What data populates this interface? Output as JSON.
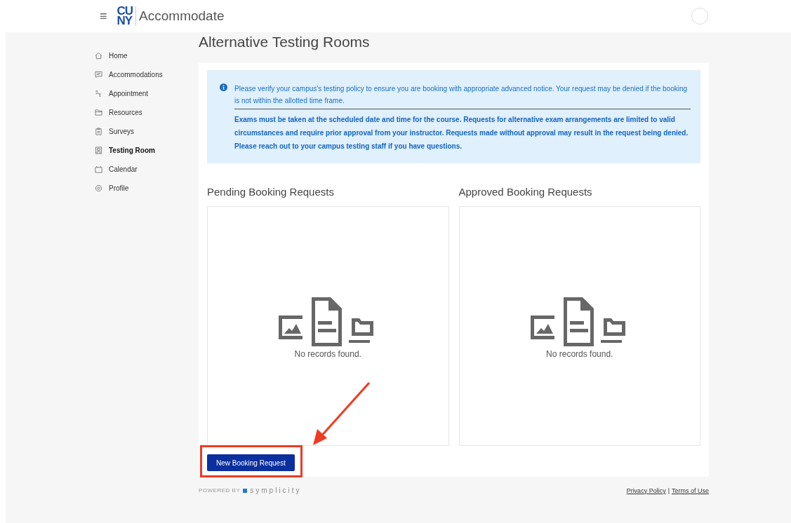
{
  "header": {
    "menu_glyph": "≡",
    "logo_lines": [
      "CU",
      "NY"
    ],
    "app_name": "Accommodate"
  },
  "sidebar": {
    "items": [
      {
        "label": "Home",
        "selected": false
      },
      {
        "label": "Accommodations",
        "selected": false
      },
      {
        "label": "Appointment",
        "selected": false
      },
      {
        "label": "Resources",
        "selected": false
      },
      {
        "label": "Surveys",
        "selected": false
      },
      {
        "label": "Testing Room",
        "selected": true
      },
      {
        "label": "Calendar",
        "selected": false
      },
      {
        "label": "Profile",
        "selected": false
      }
    ]
  },
  "page_title": "Alternative Testing Rooms",
  "notice": {
    "text": "Please verify your campus's testing policy to ensure you are booking with appropriate advanced notice. Your request may be denied if the booking is not within the allotted time frame.",
    "bold_text": "Exams must be taken at the scheduled date and time for the course. Requests for alternative exam arrangements are limited to valid circumstances and require prior approval from your instructor. Requests made without approval may result in the request being denied. Please reach out to your campus testing staff if you have questions."
  },
  "panels": [
    {
      "title": "Pending Booking Requests",
      "empty_text": "No records found."
    },
    {
      "title": "Approved Booking Requests",
      "empty_text": "No records found."
    }
  ],
  "new_button": "New Booking Request",
  "footer": {
    "powered_by": "POWERED BY",
    "brand": "symplicity",
    "links": [
      "Privacy Policy",
      "Terms of Use"
    ],
    "separator": "|"
  }
}
